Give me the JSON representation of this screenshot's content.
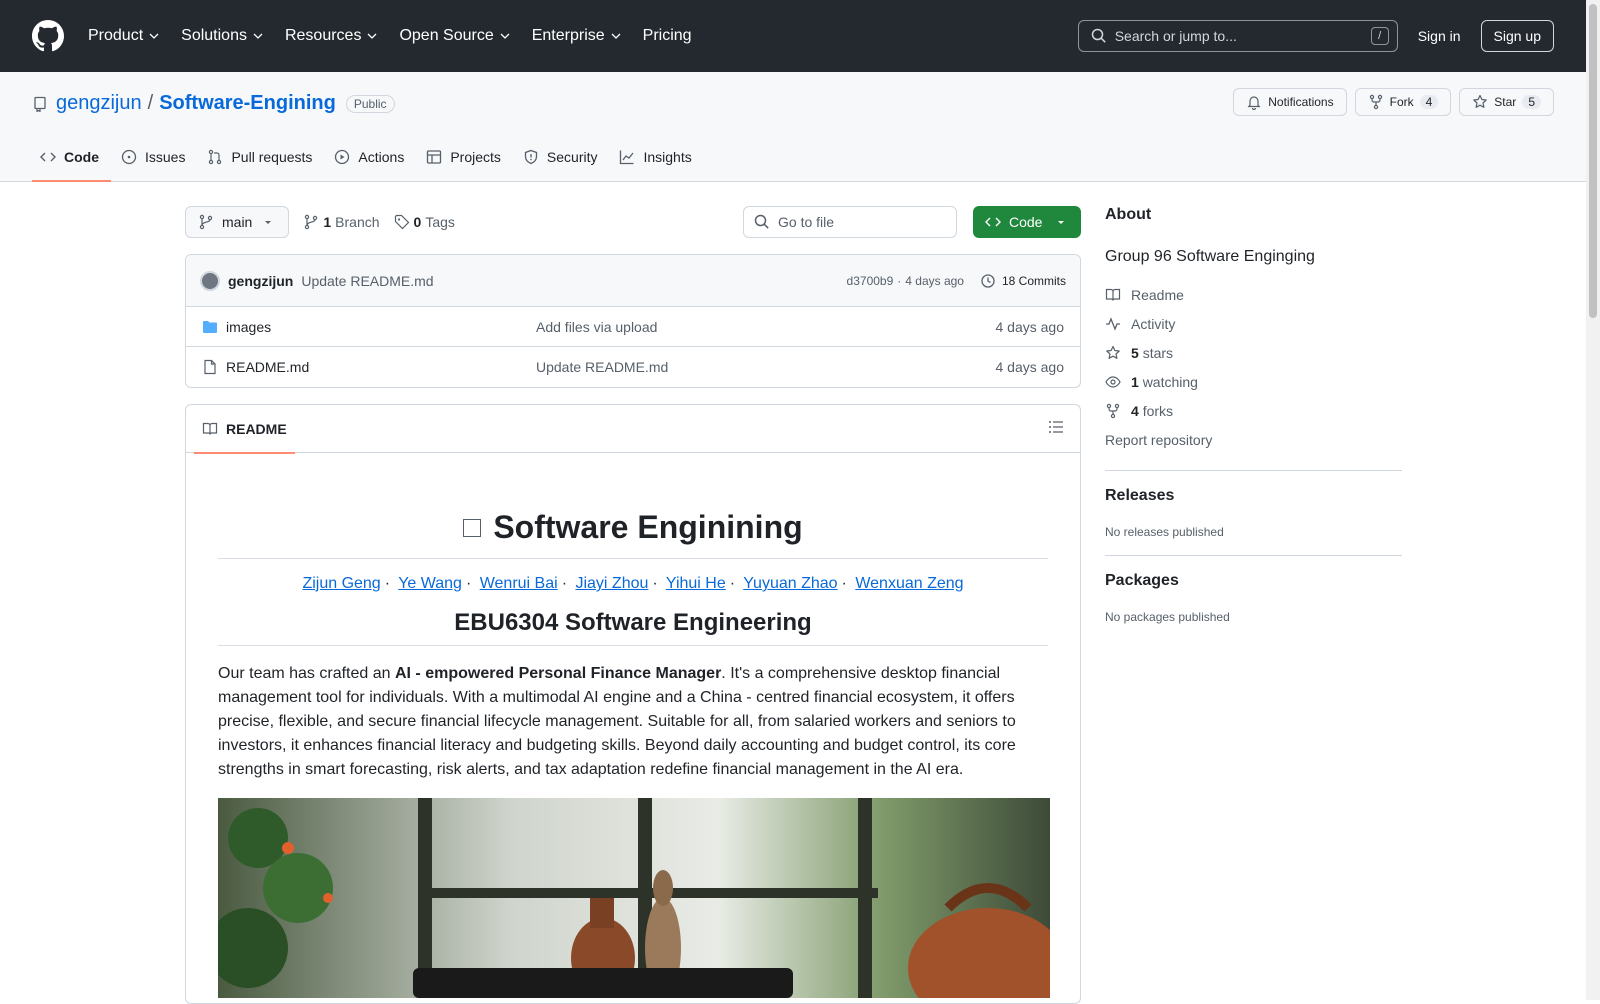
{
  "topnav": {
    "items": [
      {
        "label": "Product",
        "dropdown": true
      },
      {
        "label": "Solutions",
        "dropdown": true
      },
      {
        "label": "Resources",
        "dropdown": true
      },
      {
        "label": "Open Source",
        "dropdown": true
      },
      {
        "label": "Enterprise",
        "dropdown": true
      },
      {
        "label": "Pricing",
        "dropdown": false
      }
    ],
    "search_placeholder": "Search or jump to...",
    "search_shortcut": "/",
    "signin": "Sign in",
    "signup": "Sign up"
  },
  "repo": {
    "owner": "gengzijun",
    "separator": "/",
    "name": "Software-Engining",
    "visibility": "Public",
    "notifications_label": "Notifications",
    "fork_label": "Fork",
    "fork_count": "4",
    "star_label": "Star",
    "star_count": "5",
    "tabs": [
      {
        "label": "Code",
        "icon": "code-icon",
        "active": true
      },
      {
        "label": "Issues",
        "icon": "issue-icon"
      },
      {
        "label": "Pull requests",
        "icon": "pull-request-icon"
      },
      {
        "label": "Actions",
        "icon": "play-icon"
      },
      {
        "label": "Projects",
        "icon": "table-icon"
      },
      {
        "label": "Security",
        "icon": "shield-icon"
      },
      {
        "label": "Insights",
        "icon": "graph-icon"
      }
    ]
  },
  "filenav": {
    "branch": "main",
    "branch_count": "1",
    "branch_label": "Branch",
    "tag_count": "0",
    "tag_label": "Tags",
    "goto_placeholder": "Go to file",
    "code_label": "Code"
  },
  "commit": {
    "author": "gengzijun",
    "message": "Update README.md",
    "hash": "d3700b9",
    "separator": "·",
    "time": "4 days ago",
    "commits_label": "18 Commits"
  },
  "files": [
    {
      "name": "images",
      "type": "folder",
      "message": "Add files via upload",
      "date": "4 days ago"
    },
    {
      "name": "README.md",
      "type": "file",
      "message": "Update README.md",
      "date": "4 days ago"
    }
  ],
  "readme": {
    "tab_label": "README",
    "title": "Software Enginining",
    "authors": [
      "Zijun Geng",
      "Ye Wang",
      "Wenrui Bai",
      "Jiayi Zhou",
      "Yihui He",
      "Yuyuan Zhao",
      "Wenxuan Zeng"
    ],
    "author_separator": "·",
    "subtitle": "EBU6304 Software Engineering",
    "para_prefix": "Our team has crafted an ",
    "para_bold": "AI - empowered Personal Finance Manager",
    "para_rest": ". It's a comprehensive desktop financial management tool for individuals. With a multimodal AI engine and a China - centred financial ecosystem, it offers precise, flexible, and secure financial lifecycle management. Suitable for all, from salaried workers and seniors to investors, it enhances financial literacy and budgeting skills. Beyond daily accounting and budget control, its core strengths in smart forecasting, risk alerts, and tax adaptation redefine financial management in the AI era."
  },
  "sidebar": {
    "about_title": "About",
    "description": "Group 96 Software Enginging",
    "items": [
      {
        "icon": "book-icon",
        "label": "Readme"
      },
      {
        "icon": "pulse-icon",
        "label": "Activity"
      },
      {
        "icon": "star-icon",
        "count": "5",
        "label": "stars"
      },
      {
        "icon": "eye-icon",
        "count": "1",
        "label": "watching"
      },
      {
        "icon": "fork-icon",
        "count": "4",
        "label": "forks"
      }
    ],
    "report": "Report repository",
    "releases_title": "Releases",
    "releases_empty": "No releases published",
    "packages_title": "Packages",
    "packages_empty": "No packages published"
  },
  "colors": {
    "header_bg": "#24292f",
    "link": "#0969da",
    "primary_green": "#1f883d",
    "tab_underline": "#fd8c73"
  }
}
